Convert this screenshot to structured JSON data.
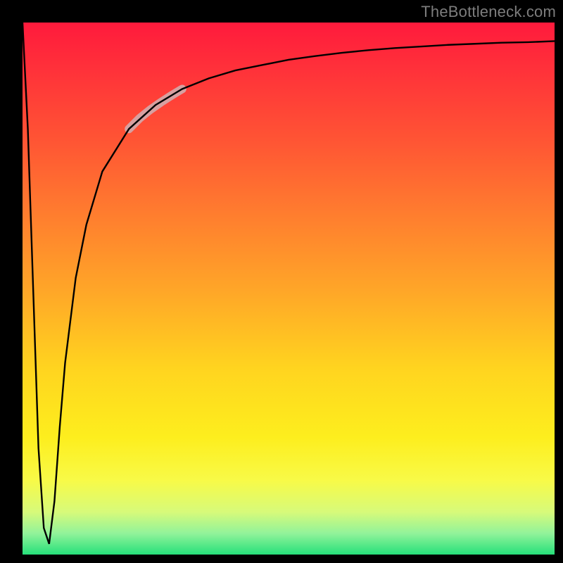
{
  "watermark": "TheBottleneck.com",
  "chart_data": {
    "type": "line",
    "title": "",
    "xlabel": "",
    "ylabel": "",
    "xlim": [
      0,
      100
    ],
    "ylim": [
      0,
      100
    ],
    "grid": false,
    "legend": false,
    "series": [
      {
        "name": "bottleneck-curve",
        "x": [
          0,
          1,
          2,
          3,
          4,
          5,
          6,
          7,
          8,
          10,
          12,
          15,
          20,
          25,
          30,
          35,
          40,
          45,
          50,
          55,
          60,
          65,
          70,
          75,
          80,
          85,
          90,
          95,
          100
        ],
        "values": [
          100,
          80,
          50,
          20,
          5,
          2,
          10,
          24,
          36,
          52,
          62,
          72,
          80,
          84.5,
          87.5,
          89.5,
          91,
          92,
          93,
          93.7,
          94.3,
          94.8,
          95.2,
          95.5,
          95.8,
          96,
          96.2,
          96.3,
          96.5
        ],
        "color": "#000000"
      },
      {
        "name": "highlight-segment",
        "x": [
          20,
          22,
          24,
          26,
          28,
          30
        ],
        "values": [
          80,
          82,
          83.6,
          85,
          86.3,
          87.5
        ],
        "color": "#d7a0a0",
        "stroke_width": 12
      }
    ],
    "gradient_stops": [
      {
        "pos": 0.0,
        "color": "#ff1a3c"
      },
      {
        "pos": 0.08,
        "color": "#ff2f3a"
      },
      {
        "pos": 0.22,
        "color": "#ff5434"
      },
      {
        "pos": 0.35,
        "color": "#ff7a2f"
      },
      {
        "pos": 0.5,
        "color": "#ffa528"
      },
      {
        "pos": 0.65,
        "color": "#ffd41f"
      },
      {
        "pos": 0.78,
        "color": "#fdee1e"
      },
      {
        "pos": 0.86,
        "color": "#f8fa47"
      },
      {
        "pos": 0.92,
        "color": "#d7fa7a"
      },
      {
        "pos": 0.96,
        "color": "#92f39a"
      },
      {
        "pos": 1.0,
        "color": "#26e07a"
      }
    ]
  }
}
